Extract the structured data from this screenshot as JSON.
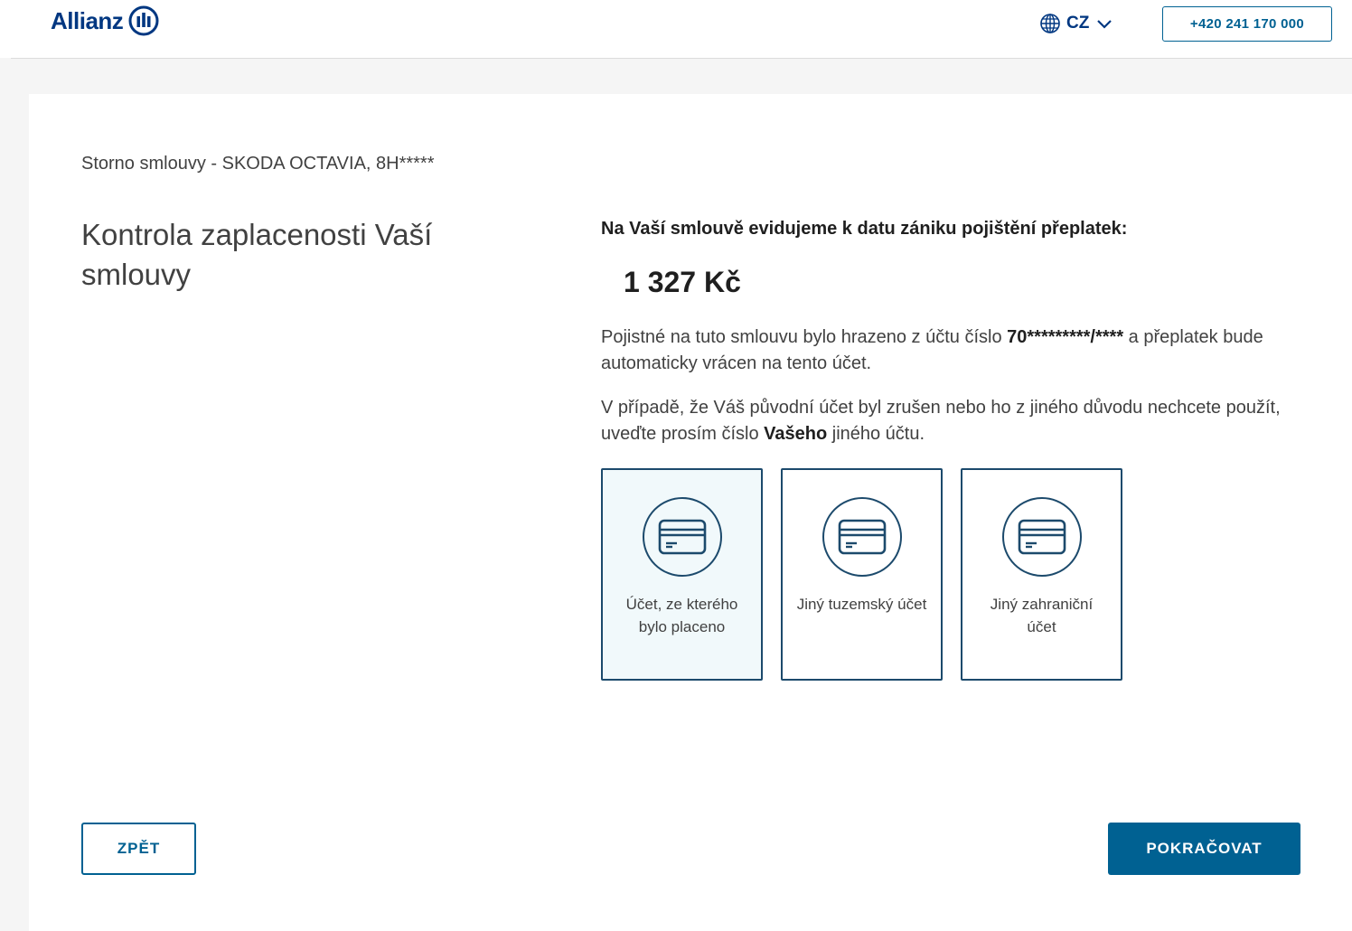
{
  "header": {
    "logo_text": "Allianz",
    "language": "CZ",
    "phone": "+420 241 170 000"
  },
  "breadcrumb": "Storno smlouvy - SKODA OCTAVIA, 8H*****",
  "page_title": "Kontrola zaplacenosti Vaší smlouvy",
  "overpayment": {
    "heading": "Na Vaší smlouvě evidujeme k datu zániku pojištění přeplatek:",
    "amount": "1 327 Kč"
  },
  "paragraph1": {
    "before": "Pojistné na tuto smlouvu bylo hrazeno z účtu číslo ",
    "account": "70*********/****",
    "after": "  a přeplatek bude automaticky vrácen na tento účet."
  },
  "paragraph2": {
    "before": "V případě, že Váš původní účet byl zrušen nebo ho z jiného důvodu nechcete použít, uveďte prosím číslo ",
    "bold": "Vašeho",
    "after": " jiného účtu."
  },
  "options": [
    {
      "label": "Účet, ze kterého bylo placeno",
      "icon": "credit-card-icon",
      "selected": true
    },
    {
      "label": "Jiný tuzemský účet",
      "icon": "credit-card-icon",
      "selected": false
    },
    {
      "label": "Jiný zahraniční účet",
      "icon": "credit-card-icon",
      "selected": false
    }
  ],
  "buttons": {
    "back": "ZPĚT",
    "next": "POKRAČOVAT"
  },
  "colors": {
    "brand_blue": "#003781",
    "button_blue": "#006192",
    "option_border": "#1c4a6c",
    "selected_bg": "#f1f9fb"
  }
}
